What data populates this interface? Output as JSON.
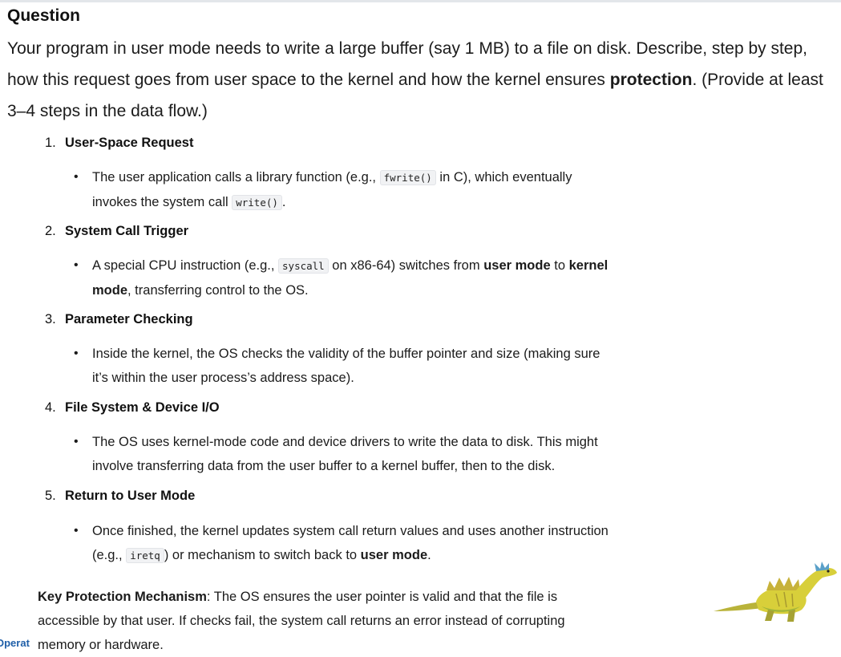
{
  "question": {
    "heading": "Question",
    "text_before_bold": "Your program in user mode needs to write a large buffer (say 1 MB) to a file on disk. Describe, step by step, how this request goes from user space to the kernel and how the kernel ensures ",
    "bold": "protection",
    "text_after_bold": ". (Provide at least 3–4 steps in the data flow.)"
  },
  "steps": [
    {
      "num": "1.",
      "title": "User-Space Request"
    },
    {
      "num": "2.",
      "title": "System Call Trigger"
    },
    {
      "num": "3.",
      "title": "Parameter Checking"
    },
    {
      "num": "4.",
      "title": "File System & Device I/O"
    },
    {
      "num": "5.",
      "title": "Return to User Mode"
    }
  ],
  "bullets": {
    "b1": {
      "t1": "The user application calls a library function (e.g., ",
      "code1": "fwrite()",
      "t2": " in C), which eventually",
      "t3": "invokes the system call ",
      "code2": "write()",
      "t4": "."
    },
    "b2": {
      "t1": "A special CPU instruction (e.g., ",
      "code1": "syscall",
      "t2": " on x86-64) switches from ",
      "bold1": "user mode",
      "t3": " to ",
      "bold2": "kernel",
      "bold3": "mode",
      "t4": ", transferring control to the OS."
    },
    "b3": {
      "line1": "Inside the kernel, the OS checks the validity of the buffer pointer and size (making sure",
      "line2": "it’s within the user process’s address space)."
    },
    "b4": {
      "line1": "The OS uses kernel-mode code and device drivers to write the data to disk. This might",
      "line2": "involve transferring data from the user buffer to a kernel buffer, then to the disk."
    },
    "b5": {
      "t1": "Once finished, the kernel updates system call return values and uses another instruction",
      "t2": "(e.g., ",
      "code1": "iretq",
      "t3": ") or mechanism to switch back to ",
      "bold1": "user mode",
      "t4": "."
    }
  },
  "key": {
    "label": "Key Protection Mechanism",
    "line1": ": The OS ensures the user pointer is valid and that the file is",
    "line2": "accessible by that user. If checks fail, the system call returns an error instead of corrupting",
    "line3": "memory or hardware."
  },
  "footer": {
    "partial_logo_text": "Operat"
  },
  "icons": {
    "mascot": "dinosaur-mascot-icon"
  },
  "colors": {
    "logo_blue": "#1f5fa8",
    "code_bg": "#f1f2f4",
    "mascot_yellow": "#d8cf3a"
  }
}
